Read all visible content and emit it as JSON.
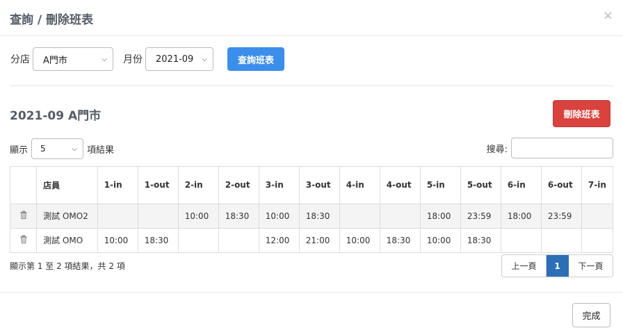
{
  "modal": {
    "title": "查詢 / 刪除班表",
    "close": "×"
  },
  "filters": {
    "branch_label": "分店",
    "branch_value": "A門市",
    "month_label": "月份",
    "month_value": "2021-09",
    "query_button": "查詢班表"
  },
  "section": {
    "title": "2021-09 A門市",
    "delete_button": "刪除班表"
  },
  "table_controls": {
    "length_prefix": "顯示",
    "length_value": "5",
    "length_suffix": "項結果",
    "search_label": "搜尋:",
    "search_value": ""
  },
  "table": {
    "headers": [
      "",
      "店員",
      "1-in",
      "1-out",
      "2-in",
      "2-out",
      "3-in",
      "3-out",
      "4-in",
      "4-out",
      "5-in",
      "5-out",
      "6-in",
      "6-out",
      "7-in"
    ],
    "rows": [
      {
        "icon": "trash-icon",
        "cells": [
          "測試 OMO2",
          "",
          "",
          "10:00",
          "18:30",
          "10:00",
          "18:30",
          "",
          "",
          "18:00",
          "23:59",
          "18:00",
          "23:59",
          ""
        ]
      },
      {
        "icon": "trash-icon",
        "cells": [
          "測試 OMO",
          "10:00",
          "18:30",
          "",
          "",
          "12:00",
          "21:00",
          "10:00",
          "18:30",
          "10:00",
          "18:30",
          "",
          "",
          ""
        ]
      }
    ]
  },
  "footer_info": "顯示第 1 至 2 項結果，共 2 項",
  "pagination": {
    "prev": "上一頁",
    "current": "1",
    "next": "下一頁"
  },
  "done_button": "完成",
  "colors": {
    "primary": "#3b8eea",
    "danger": "#d9423d",
    "page_active": "#2d6fb7"
  }
}
